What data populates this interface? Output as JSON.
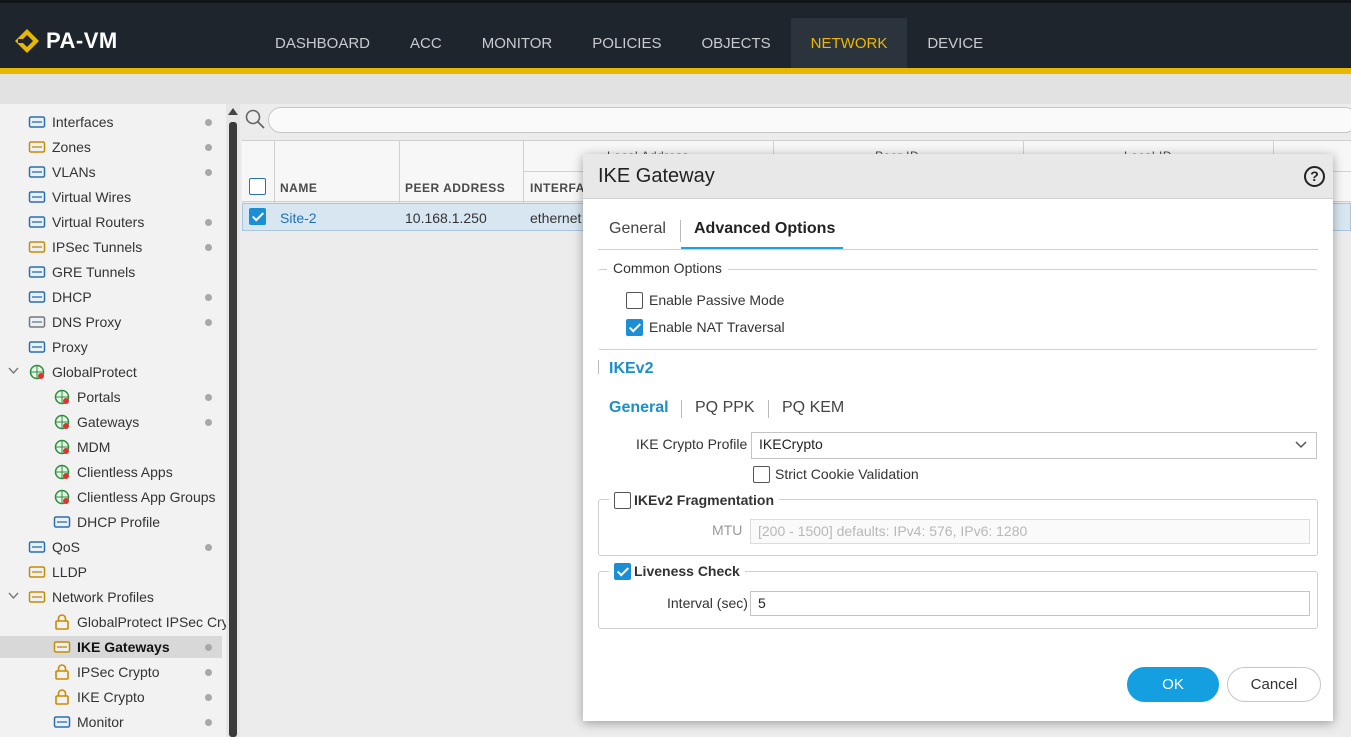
{
  "app": {
    "logo": "PA-VM"
  },
  "nav": {
    "tabs": [
      "DASHBOARD",
      "ACC",
      "MONITOR",
      "POLICIES",
      "OBJECTS",
      "NETWORK",
      "DEVICE"
    ],
    "active": "NETWORK"
  },
  "sidebar": {
    "items": [
      {
        "label": "Interfaces",
        "icon": "interfaces-icon",
        "dot": true
      },
      {
        "label": "Zones",
        "icon": "zones-icon",
        "dot": true
      },
      {
        "label": "VLANs",
        "icon": "vlans-icon",
        "dot": true
      },
      {
        "label": "Virtual Wires",
        "icon": "virtual-wires-icon",
        "dot": false
      },
      {
        "label": "Virtual Routers",
        "icon": "virtual-routers-icon",
        "dot": true
      },
      {
        "label": "IPSec Tunnels",
        "icon": "ipsec-tunnels-icon",
        "dot": true
      },
      {
        "label": "GRE Tunnels",
        "icon": "gre-tunnels-icon",
        "dot": false
      },
      {
        "label": "DHCP",
        "icon": "dhcp-icon",
        "dot": true
      },
      {
        "label": "DNS Proxy",
        "icon": "dns-proxy-icon",
        "dot": true
      },
      {
        "label": "Proxy",
        "icon": "proxy-icon",
        "dot": false
      },
      {
        "label": "GlobalProtect",
        "icon": "globalprotect-icon",
        "dot": false
      },
      {
        "label": "Portals",
        "icon": "portals-icon",
        "dot": true
      },
      {
        "label": "Gateways",
        "icon": "gateways-icon",
        "dot": true
      },
      {
        "label": "MDM",
        "icon": "mdm-icon",
        "dot": false
      },
      {
        "label": "Clientless Apps",
        "icon": "clientless-apps-icon",
        "dot": false
      },
      {
        "label": "Clientless App Groups",
        "icon": "clientless-app-groups-icon",
        "dot": false
      },
      {
        "label": "DHCP Profile",
        "icon": "dhcp-profile-icon",
        "dot": false
      },
      {
        "label": "QoS",
        "icon": "qos-icon",
        "dot": true
      },
      {
        "label": "LLDP",
        "icon": "lldp-icon",
        "dot": false
      },
      {
        "label": "Network Profiles",
        "icon": "network-profiles-icon",
        "dot": false
      },
      {
        "label": "GlobalProtect IPSec Cry",
        "icon": "lock-icon",
        "dot": false
      },
      {
        "label": "IKE Gateways",
        "icon": "ike-gateways-icon",
        "dot": true
      },
      {
        "label": "IPSec Crypto",
        "icon": "lock-icon",
        "dot": true
      },
      {
        "label": "IKE Crypto",
        "icon": "lock-icon",
        "dot": true
      },
      {
        "label": "Monitor",
        "icon": "monitor-icon",
        "dot": true
      }
    ]
  },
  "grid": {
    "group_headers": [
      "Local Address",
      "Peer ID",
      "Local ID"
    ],
    "columns": [
      "NAME",
      "PEER ADDRESS",
      "INTERFA"
    ],
    "rows": [
      {
        "name": "Site-2",
        "peer_address": "10.168.1.250",
        "interface": "ethernet"
      }
    ]
  },
  "modal": {
    "title": "IKE Gateway",
    "help": "?",
    "tabs": [
      "General",
      "Advanced Options"
    ],
    "active_tab": "Advanced Options",
    "common_options": {
      "legend": "Common Options",
      "passive_mode": {
        "label": "Enable Passive Mode",
        "checked": false
      },
      "nat_traversal": {
        "label": "Enable NAT Traversal",
        "checked": true
      }
    },
    "ikev2": {
      "title": "IKEv2",
      "subtabs": [
        "General",
        "PQ PPK",
        "PQ KEM"
      ],
      "active_subtab": "General",
      "crypto_profile_label": "IKE Crypto Profile",
      "crypto_profile_value": "IKECrypto",
      "strict_cookie": {
        "label": "Strict Cookie Validation",
        "checked": false
      },
      "fragmentation": {
        "label": "IKEv2 Fragmentation",
        "checked": false,
        "mtu_label": "MTU",
        "mtu_placeholder": "[200 - 1500] defaults: IPv4: 576, IPv6: 1280"
      },
      "liveness": {
        "label": "Liveness Check",
        "checked": true,
        "interval_label": "Interval (sec)",
        "interval_value": "5"
      }
    },
    "ok_label": "OK",
    "cancel_label": "Cancel"
  },
  "colors": {
    "accent": "#14a0e0",
    "nav_bg": "#1e252d",
    "nav_active": "#f0b600",
    "yellow_bar": "#e8b800"
  }
}
